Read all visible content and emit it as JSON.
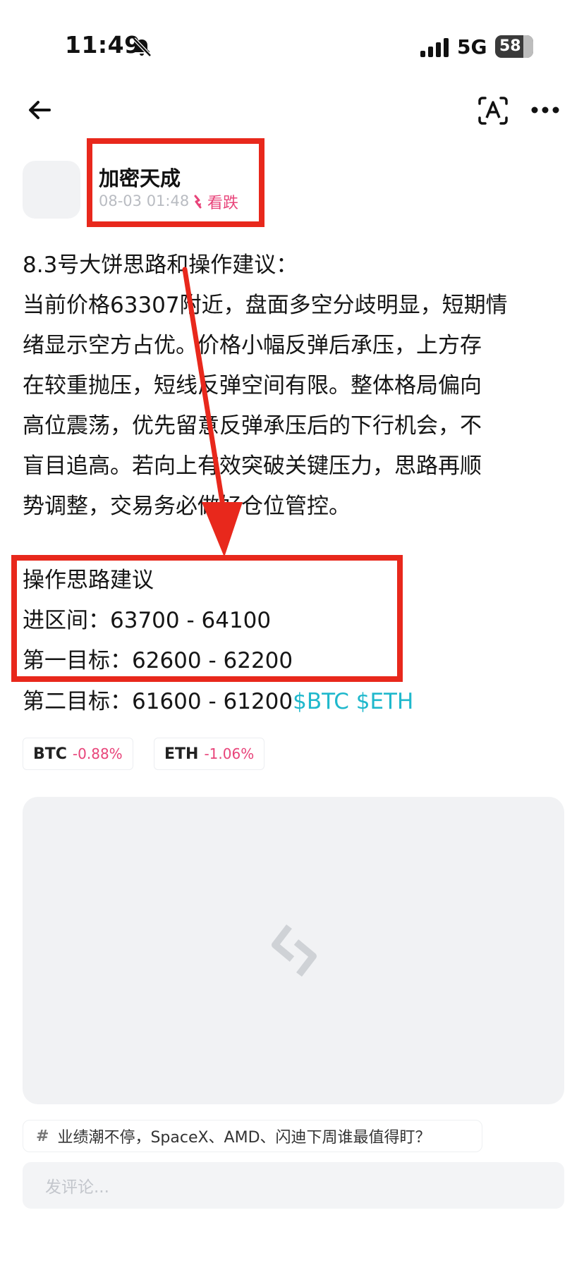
{
  "status_bar": {
    "time": "11:49",
    "network": "5G",
    "battery": "58"
  },
  "author": {
    "name": "加密天成",
    "time": "08-03 01:48",
    "stance": "看跌"
  },
  "post": {
    "lines": [
      "8.3号大饼思路和操作建议：",
      "当前价格63307附近，盘面多空分歧明显，短期情",
      "绪显示空方占优。价格小幅反弹后承压，上方存",
      "在较重抛压，短线反弹空间有限。整体格局偏向",
      "高位震荡，优先留意反弹承压后的下行机会，不",
      "盲目追高。若向上有效突破关键压力，思路再顺",
      "势调整，交易务必做好仓位管控。"
    ],
    "strategy_title": "操作思路建议",
    "entry": "进区间：63700 - 64100",
    "target1": "第一目标：62600 - 62200",
    "target2": "第二目标：61600 - 61200",
    "hashtags": "$BTC $ETH"
  },
  "tickers": [
    {
      "symbol": "BTC",
      "change": "-0.88%"
    },
    {
      "symbol": "ETH",
      "change": "-1.06%"
    }
  ],
  "topic": {
    "hash": "#",
    "text": "业绩潮不停，SpaceX、AMD、闪迪下周谁最值得盯？"
  },
  "comment": {
    "placeholder": "发评论..."
  },
  "colors": {
    "accent": "#1fb8cc",
    "bearish": "#e8447a",
    "annotation": "#e8281c"
  },
  "icons": [
    "bell-off-icon",
    "signal-icon",
    "battery-icon",
    "back-arrow-icon",
    "translate-icon",
    "more-icon",
    "down-arrow-icon",
    "brand-logo-icon"
  ]
}
